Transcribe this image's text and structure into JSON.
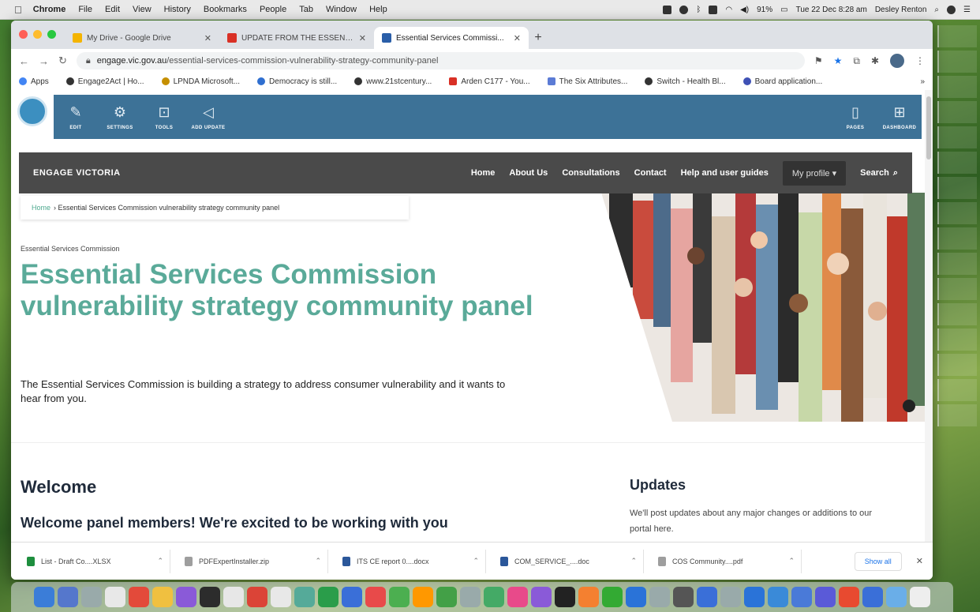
{
  "menubar": {
    "items": [
      "Chrome",
      "File",
      "Edit",
      "View",
      "History",
      "Bookmarks",
      "People",
      "Tab",
      "Window",
      "Help"
    ],
    "battery": "91%",
    "clock": "Tue 22 Dec  8:28 am",
    "user": "Desley Renton"
  },
  "tabs": [
    {
      "title": "My Drive - Google Drive",
      "color": "#f4b400"
    },
    {
      "title": "UPDATE FROM THE ESSENTI...",
      "color": "#d93025"
    },
    {
      "title": "Essential Services Commissi...",
      "color": "#2a5ea8"
    }
  ],
  "address": {
    "host": "engage.vic.gov.au",
    "path": "/essential-services-commission-vulnerability-strategy-community-panel"
  },
  "bookmarks": [
    {
      "label": "Apps",
      "color": "#4285f4"
    },
    {
      "label": "Engage2Act | Ho...",
      "color": "#333333"
    },
    {
      "label": "LPNDA Microsoft...",
      "color": "#c58f00"
    },
    {
      "label": "Democracy is still...",
      "color": "#2f6fd0"
    },
    {
      "label": "www.21stcentury...",
      "color": "#333333"
    },
    {
      "label": "Arden C177 - You...",
      "color": "#d93025"
    },
    {
      "label": "The Six Attributes...",
      "color": "#5b7bd5"
    },
    {
      "label": "Switch - Health Bl...",
      "color": "#333333"
    },
    {
      "label": "Board application...",
      "color": "#3f51b5"
    }
  ],
  "cms": {
    "left": [
      {
        "label": "EDIT",
        "icon": "✎",
        "name": "edit-icon"
      },
      {
        "label": "SETTINGS",
        "icon": "⚙",
        "name": "settings-icon"
      },
      {
        "label": "TOOLS",
        "icon": "⊡",
        "name": "tools-icon"
      },
      {
        "label": "ADD UPDATE",
        "icon": "◁",
        "name": "megaphone-icon"
      }
    ],
    "right": [
      {
        "label": "PAGES",
        "icon": "▯",
        "name": "pages-icon"
      },
      {
        "label": "DASHBOARD",
        "icon": "⊞",
        "name": "dashboard-icon"
      }
    ]
  },
  "sitenav": {
    "brand": "ENGAGE VICTORIA",
    "links": [
      "Home",
      "About Us",
      "Consultations",
      "Contact",
      "Help and user guides"
    ],
    "profile": "My profile ▾",
    "search": "Search"
  },
  "breadcrumb": {
    "home": "Home",
    "current": "› Essential Services Commission vulnerability strategy community panel"
  },
  "page": {
    "org": "Essential Services Commission",
    "title": "Essential Services Commission vulnerability strategy community panel",
    "intro": "The Essential Services Commission is building a strategy to address consumer vulnerability and it wants to hear from you.",
    "welcome_heading": "Welcome",
    "welcome_sub": "Welcome panel members! We're excited to be working with you",
    "updates_heading": "Updates",
    "updates_text": "We'll post updates about any major changes or additions to our portal here."
  },
  "downloads": [
    {
      "name": "List - Draft Co....XLSX",
      "color": "#1e8e3e"
    },
    {
      "name": "PDFExpertInstaller.zip",
      "color": "#9e9e9e"
    },
    {
      "name": "ITS CE report 0....docx",
      "color": "#2b579a"
    },
    {
      "name": "COM_SERVICE_....doc",
      "color": "#2b579a"
    },
    {
      "name": "COS Community....pdf",
      "color": "#9e9e9e"
    }
  ],
  "shelf": {
    "show_all": "Show all"
  },
  "dock_colors": [
    "#3b7dd8",
    "#5577cc",
    "#9aa",
    "#e8e8e8",
    "#e34a3a",
    "#f0c040",
    "#8a5ad8",
    "#2c2c2c",
    "#e7e7e7",
    "#db4437",
    "#e8e8e8",
    "#5a9",
    "#2a9d4a",
    "#3a6fd8",
    "#e84a4a",
    "#4caf50",
    "#ff9800",
    "#43a047",
    "#9aa",
    "#4a6",
    "#e84a8a",
    "#8a5ad8",
    "#222",
    "#f48030",
    "#3a3",
    "#2a73d8",
    "#9aa",
    "#555",
    "#3a6fd8",
    "#9aa",
    "#2a73d8",
    "#3a8ad8",
    "#4a7ad8",
    "#5a5ad8",
    "#e84a30",
    "#3a6fd8",
    "#6aaee8",
    "#eee"
  ]
}
